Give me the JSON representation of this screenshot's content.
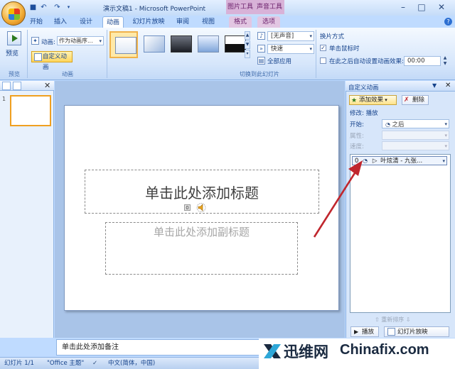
{
  "window": {
    "title": "演示文稿1 - Microsoft PowerPoint",
    "context_tabs": [
      "图片工具",
      "声音工具"
    ]
  },
  "tabs": [
    "开始",
    "插入",
    "设计",
    "动画",
    "幻灯片放映",
    "审阅",
    "视图",
    "格式",
    "选项"
  ],
  "ribbon": {
    "preview": {
      "label": "预览",
      "group_label": "预览"
    },
    "animation": {
      "anim_label": "动画:",
      "anim_value": "作为动画序...",
      "custom_button": "自定义动画",
      "group_label": "动画"
    },
    "transition": {
      "sound_value": "[无声音]",
      "speed_value": "快速",
      "apply_all": "全部应用",
      "group_label": "切换到此幻灯片"
    },
    "advance": {
      "header": "换片方式",
      "on_click": "单击鼠标时",
      "on_click_checked": true,
      "auto_label": "在此之后自动设置动画效果:",
      "auto_checked": false,
      "time_value": "00:00"
    }
  },
  "slides_pane": {
    "slide_number": "1"
  },
  "slide": {
    "title_placeholder": "单击此处添加标题",
    "subtitle_placeholder": "单击此处添加副标题",
    "anim_tag": "0"
  },
  "notes": {
    "placeholder": "单击此处添加备注"
  },
  "task_pane": {
    "title": "自定义动画",
    "add_effect": "添加效果",
    "remove": "删除",
    "modify_label": "修改: 播放",
    "start_label": "开始:",
    "start_value": "之后",
    "property_label": "属性:",
    "speed_label": "速度:",
    "list_item": {
      "index": "0",
      "name": "叶炫清 - 九张..."
    },
    "reorder": "重新排序",
    "play": "播放",
    "slideshow": "幻灯片放映"
  },
  "status": {
    "slide_info": "幻灯片 1/1",
    "theme": "\"Office 主题\"",
    "language": "中文(简体，中国)"
  },
  "watermark": {
    "cn": "迅维网",
    "en": "Chinafix.com"
  },
  "colors": {
    "ribbon_bg": "#d6e6fb",
    "selected_button": "#ffd65c",
    "context_tab": "#d8b2d8",
    "arrow": "#c0262d"
  }
}
